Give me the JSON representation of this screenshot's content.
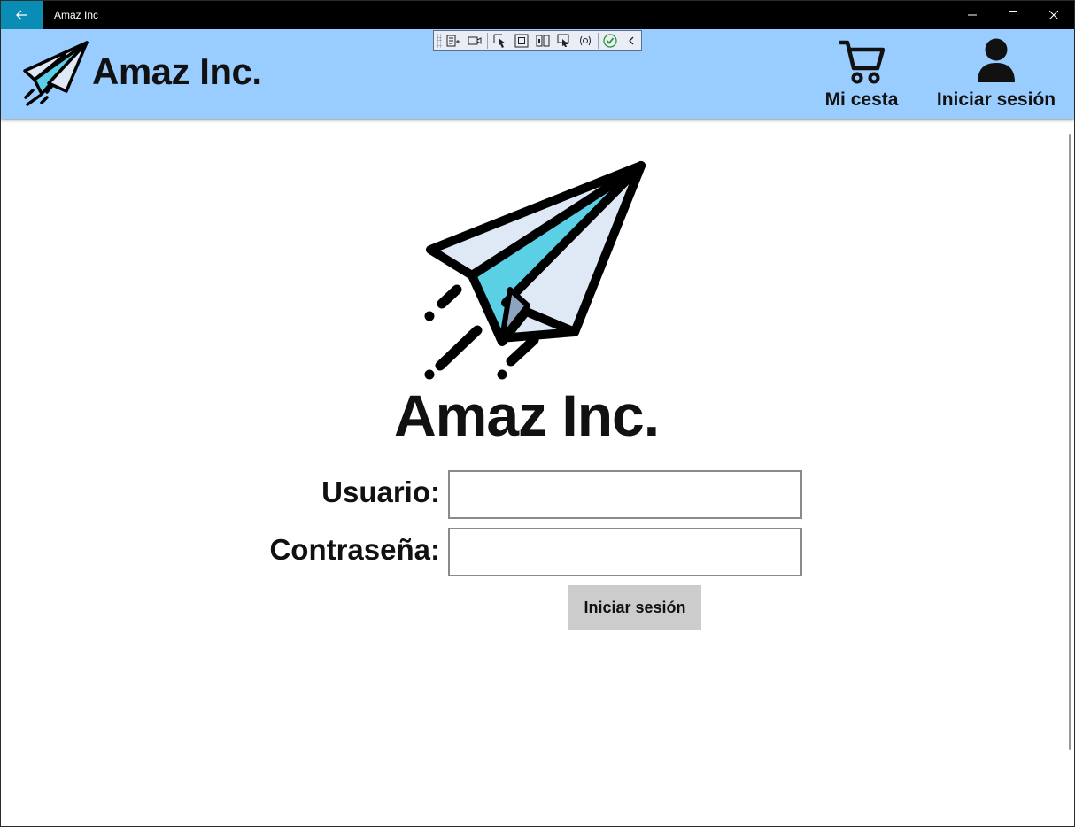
{
  "window": {
    "title": "Amaz Inc"
  },
  "header": {
    "brand": "Amaz Inc.",
    "cart_label": "Mi cesta",
    "login_label": "Iniciar sesión",
    "background": "#99ccff"
  },
  "debug_toolbar": {
    "icons": [
      "live-visual-tree-icon",
      "record-icon",
      "select-element-icon",
      "display-layout-adorners-icon",
      "track-focus-icon",
      "preview-selection-icon",
      "binding-failures-icon",
      "hot-reload-ok-icon",
      "collapse-chevron-icon"
    ]
  },
  "main": {
    "brand": "Amaz Inc.",
    "form": {
      "user_label": "Usuario:",
      "user_value": "",
      "password_label": "Contraseña:",
      "password_value": "",
      "submit_label": "Iniciar sesión"
    }
  },
  "colors": {
    "accent": "#0a8db5",
    "plane_fill": "#dfe8f5",
    "plane_accent": "#5bd0e4",
    "button_bg": "#cccccc"
  }
}
